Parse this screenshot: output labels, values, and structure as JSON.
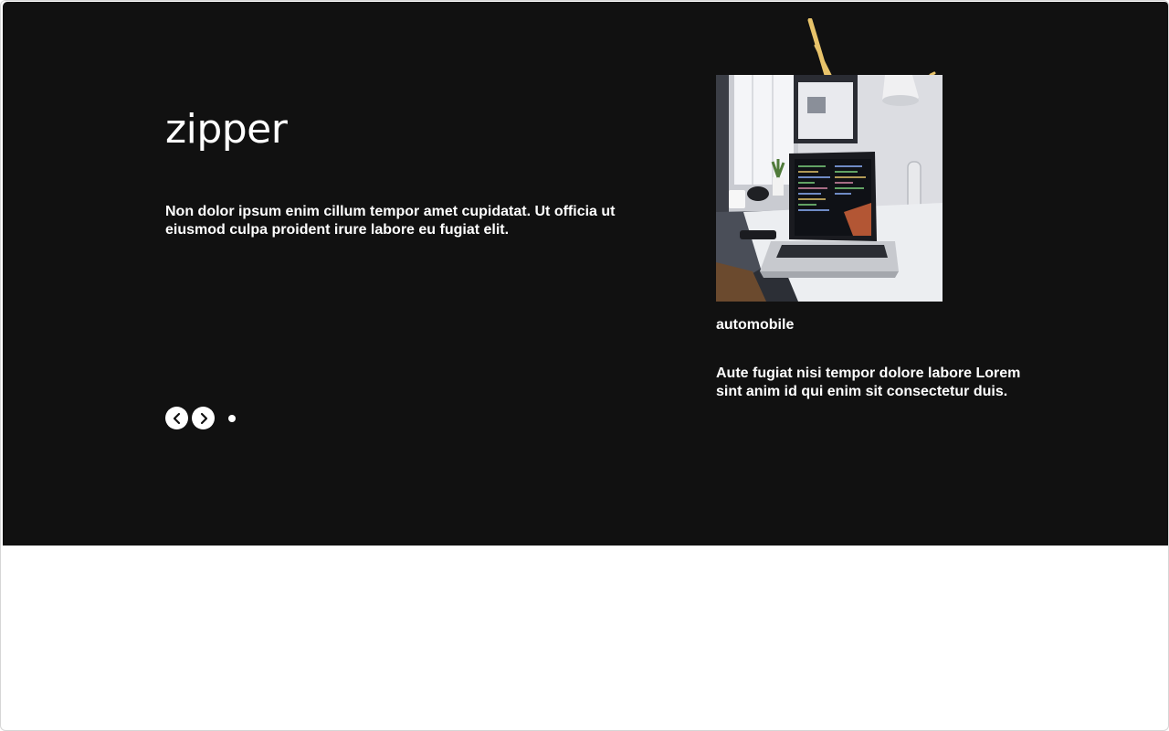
{
  "hero": {
    "title": "zipper",
    "description": "Non dolor ipsum enim cillum tempor amet cupidatat. Ut officia ut eiusmod culpa proident irure labore eu fugiat elit.",
    "background_color": "#111111",
    "controls": {
      "prev_icon": "chevron-left-icon",
      "next_icon": "chevron-right-icon",
      "dot_count": 1
    }
  },
  "card": {
    "image_icon": "laptop-on-desk-photo",
    "label": "automobile",
    "description": "Aute fugiat nisi tempor dolore labore Lorem sint anim id qui enim sit consectetur duis."
  },
  "colors": {
    "accent_ribbon": "#e8c36a",
    "text": "#ffffff",
    "page_background": "#ffffff"
  }
}
